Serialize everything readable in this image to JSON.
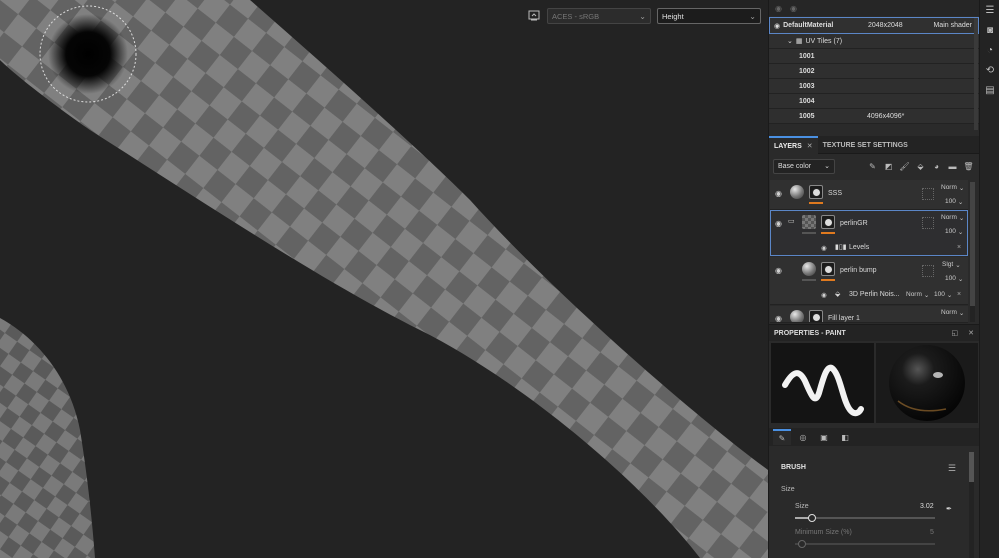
{
  "viewport": {
    "colorspace": "ACES - sRGB",
    "channel": "Height"
  },
  "texture_set": {
    "material": "DefaultMaterial",
    "resolution": "2048x2048",
    "shader": "Main shader",
    "uv_group": "UV Tiles (7)",
    "tiles": [
      {
        "id": "1001",
        "res": ""
      },
      {
        "id": "1002",
        "res": ""
      },
      {
        "id": "1003",
        "res": ""
      },
      {
        "id": "1004",
        "res": ""
      },
      {
        "id": "1005",
        "res": "4096x4096*"
      }
    ]
  },
  "layers_panel": {
    "tab_layers": "LAYERS",
    "tab_texture_set": "TEXTURE SET SETTINGS",
    "channel_select": "Base color",
    "layers": [
      {
        "name": "SSS",
        "blend": "Norm",
        "opacity": "100"
      },
      {
        "name": "perlinGR",
        "blend": "Norm",
        "opacity": "100",
        "effect": "Levels"
      },
      {
        "name": "perlin bump",
        "blend": "Slgt",
        "opacity": "100",
        "effect": "3D Perlin Nois...",
        "effect_blend": "Norm",
        "effect_opacity": "100"
      },
      {
        "name": "Fill layer 1",
        "blend": "Norm"
      }
    ]
  },
  "properties": {
    "title": "PROPERTIES - PAINT",
    "section": "BRUSH",
    "group": "Size",
    "size_label": "Size",
    "size_value": "3.02",
    "size_fraction": 0.12,
    "min_size_label": "Minimum Size (%)",
    "min_size_value": "5",
    "min_size_fraction": 0.05
  }
}
